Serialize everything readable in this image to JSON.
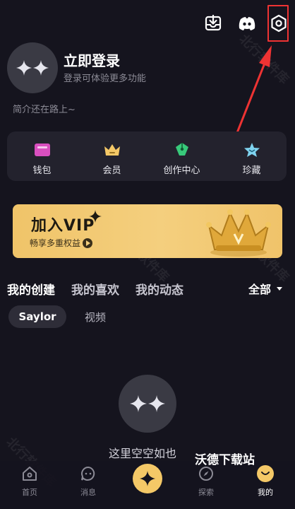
{
  "top_bar": {
    "icons": [
      "download-box-icon",
      "discord-icon",
      "settings-hexagon-icon"
    ]
  },
  "profile": {
    "login_title": "立即登录",
    "login_subtitle": "登录可体验更多功能",
    "bio": "简介还在路上~"
  },
  "quick_actions": [
    {
      "label": "钱包",
      "icon": "wallet-icon",
      "color": "#d94fbf"
    },
    {
      "label": "会员",
      "icon": "crown-icon",
      "color": "#f4c867"
    },
    {
      "label": "创作中心",
      "icon": "pen-icon",
      "color": "#38c97a"
    },
    {
      "label": "珍藏",
      "icon": "star-icon",
      "color": "#7fd3ef"
    }
  ],
  "vip_banner": {
    "title": "加入VIP",
    "subtitle": "畅享多重权益"
  },
  "content_tabs": {
    "tabs": [
      "我的创建",
      "我的喜欢",
      "我的动态"
    ],
    "active_index": 0,
    "filter_label": "全部"
  },
  "sub_filters": {
    "active": "Saylor",
    "other": "视频"
  },
  "empty_state": {
    "text": "这里空空如也"
  },
  "watermark": {
    "logo_text": "沃德下载站",
    "diagonal_text": "北行软件库"
  },
  "bottom_nav": [
    {
      "label": "首页",
      "icon": "home-icon"
    },
    {
      "label": "消息",
      "icon": "message-icon"
    },
    {
      "label": "",
      "icon": "sparkle-create-icon"
    },
    {
      "label": "探索",
      "icon": "compass-icon"
    },
    {
      "label": "我的",
      "icon": "me-face-icon"
    }
  ],
  "colors": {
    "background": "#15141e",
    "accent_gold": "#f4c867",
    "highlight_red": "#e33333"
  }
}
